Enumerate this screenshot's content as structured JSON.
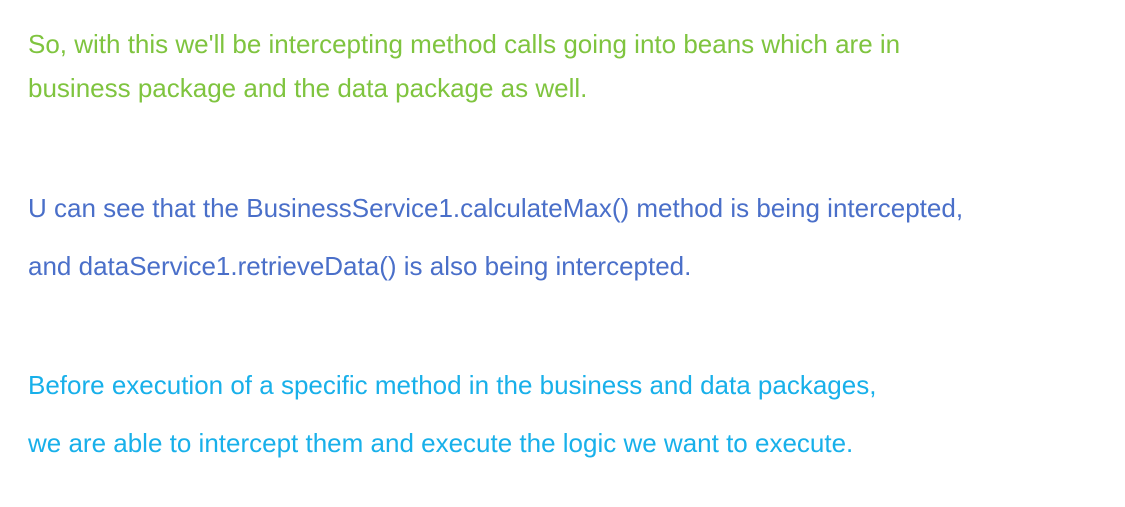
{
  "paragraphs": [
    {
      "color": "#7fc43f",
      "lines": [
        "So, with this we'll be intercepting method calls going into beans which are in",
        "business package and the data package as well."
      ]
    },
    {
      "color": "#4a6fc9",
      "lines": [
        "U can see that the BusinessService1.calculateMax() method is being intercepted,",
        "and dataService1.retrieveData() is also being intercepted."
      ]
    },
    {
      "color": "#18b0ea",
      "lines": [
        "Before execution of a specific method in the business and data packages,",
        "we are able to intercept them and execute the logic we want to execute."
      ]
    }
  ]
}
